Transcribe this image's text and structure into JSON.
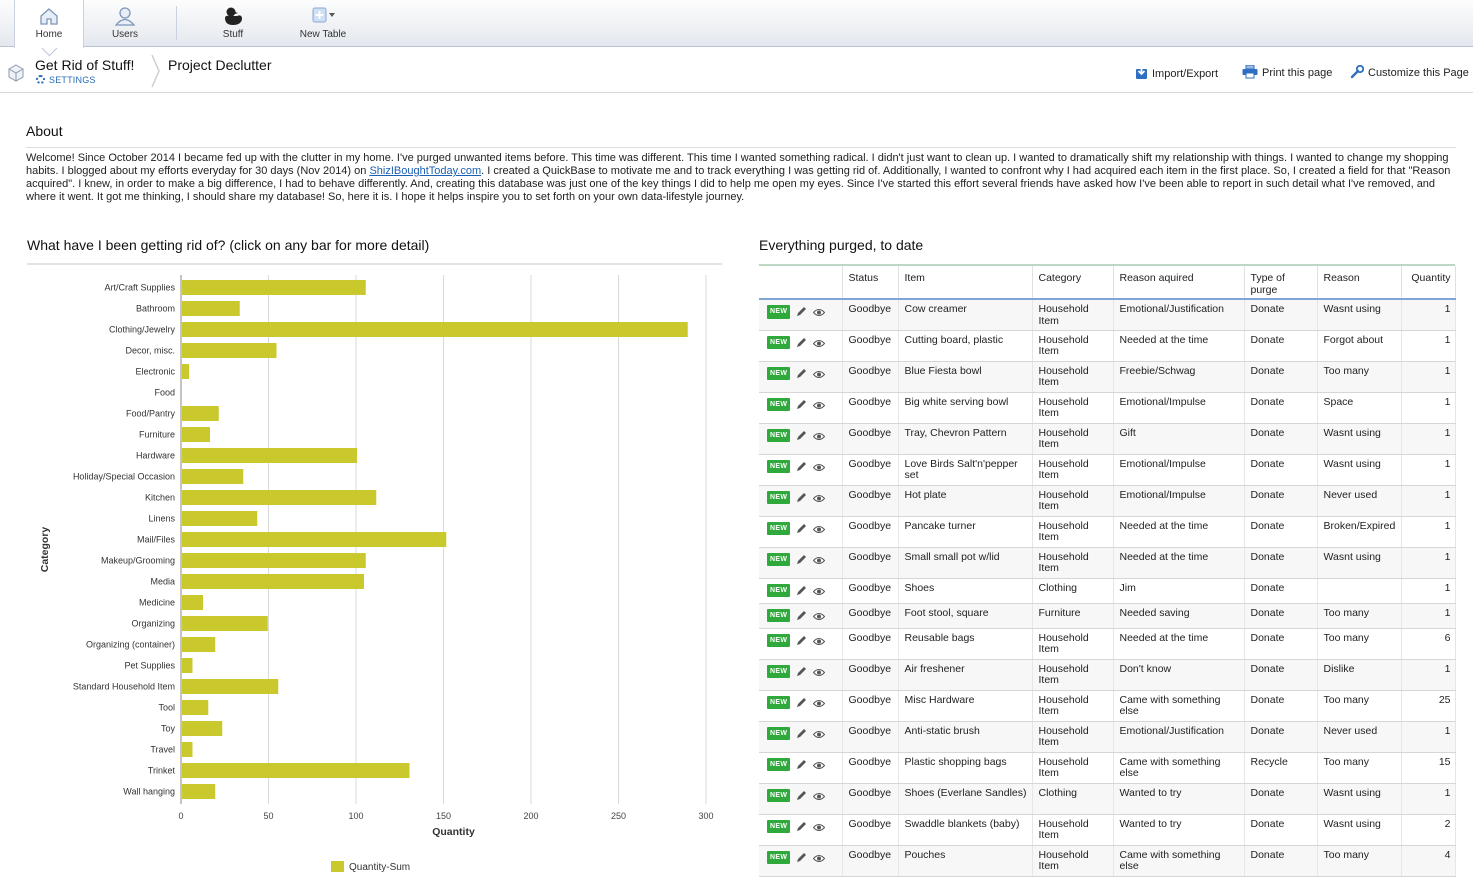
{
  "nav": {
    "items": [
      {
        "label": "Home"
      },
      {
        "label": "Users"
      },
      {
        "label": "Stuff"
      },
      {
        "label": "New Table"
      }
    ]
  },
  "header": {
    "app_title": "Get Rid of Stuff!",
    "settings_label": "SETTINGS",
    "page_name": "Project Declutter",
    "import_export": "Import/Export",
    "print_page": "Print this page",
    "customize_page": "Customize this Page"
  },
  "about": {
    "title": "About",
    "text_before_link": "Welcome! Since October 2014 I became fed up with the clutter in my home. I've purged unwanted items before. This time was different. This time I wanted something radical. I didn't just want to clean up. I wanted to dramatically shift my relationship with things. I wanted to change my shopping habits. I blogged about my efforts everyday for 30 days (Nov 2014) on ",
    "link_text": "ShizIBoughtToday.com",
    "text_after_link": ". I created a QuickBase to motivate me and to track everything I was getting rid of. Additionally, I wanted to confront why I had acquired each item in the first place. So, I created a field for that \"Reason acquired\".  I knew, in order to make a big difference, I had to behave differently. And, creating this database was just one of the key things I did to help me open my eyes. Since I've started this effort several friends have asked how I've been able to report in such detail what I've removed, and where it went. It got me thinking, I should share my database! So, here it is. I hope it helps inspire you to set forth on your own data-lifestyle journey."
  },
  "chart_title": "What have I been getting rid of? (click on any bar for more detail)",
  "chart_data": {
    "type": "bar",
    "orientation": "horizontal",
    "categories": [
      "Art/Craft Supplies",
      "Bathroom",
      "Clothing/Jewelry",
      "Decor, misc.",
      "Electronic",
      "Food",
      "Food/Pantry",
      "Furniture",
      "Hardware",
      "Holiday/Special Occasion",
      "Kitchen",
      "Linens",
      "Mail/Files",
      "Makeup/Grooming",
      "Media",
      "Medicine",
      "Organizing",
      "Organizing (container)",
      "Pet Supplies",
      "Standard Household Item",
      "Tool",
      "Toy",
      "Travel",
      "Trinket",
      "Wall hanging"
    ],
    "series": [
      {
        "name": "Quantity-Sum",
        "values": [
          105,
          33,
          289,
          54,
          4,
          0,
          21,
          16,
          100,
          35,
          111,
          43,
          151,
          105,
          104,
          12,
          49,
          19,
          6,
          55,
          15,
          23,
          6,
          130,
          19
        ]
      }
    ],
    "xlabel": "Quantity",
    "ylabel": "Category",
    "xlim": [
      0,
      300
    ],
    "xticks": [
      "0",
      "50",
      "100",
      "150",
      "200",
      "250",
      "300"
    ],
    "grid": true,
    "legend": "bottom",
    "bar_color": "#c9c92e"
  },
  "table": {
    "title": "Everything purged, to date",
    "badge_label": "NEW",
    "columns": [
      "Status",
      "Item",
      "Category",
      "Reason aquired",
      "Type of purge",
      "Reason",
      "Quantity"
    ],
    "rows": [
      {
        "status": "Goodbye",
        "item": "Cow creamer",
        "category": "Household Item",
        "reason_acquired": "Emotional/Justification",
        "purge_type": "Donate",
        "reason": "Wasnt using",
        "quantity": "1"
      },
      {
        "status": "Goodbye",
        "item": "Cutting board, plastic",
        "category": "Household Item",
        "reason_acquired": "Needed at the time",
        "purge_type": "Donate",
        "reason": "Forgot about",
        "quantity": "1"
      },
      {
        "status": "Goodbye",
        "item": "Blue Fiesta bowl",
        "category": "Household Item",
        "reason_acquired": "Freebie/Schwag",
        "purge_type": "Donate",
        "reason": "Too many",
        "quantity": "1"
      },
      {
        "status": "Goodbye",
        "item": "Big white serving bowl",
        "category": "Household Item",
        "reason_acquired": "Emotional/Impulse",
        "purge_type": "Donate",
        "reason": "Space",
        "quantity": "1"
      },
      {
        "status": "Goodbye",
        "item": "Tray, Chevron Pattern",
        "category": "Household Item",
        "reason_acquired": "Gift",
        "purge_type": "Donate",
        "reason": "Wasnt using",
        "quantity": "1"
      },
      {
        "status": "Goodbye",
        "item": "Love Birds Salt'n'pepper set",
        "category": "Household Item",
        "reason_acquired": "Emotional/Impulse",
        "purge_type": "Donate",
        "reason": "Wasnt using",
        "quantity": "1"
      },
      {
        "status": "Goodbye",
        "item": "Hot plate",
        "category": "Household Item",
        "reason_acquired": "Emotional/Impulse",
        "purge_type": "Donate",
        "reason": "Never used",
        "quantity": "1"
      },
      {
        "status": "Goodbye",
        "item": "Pancake turner",
        "category": "Household Item",
        "reason_acquired": "Needed at the time",
        "purge_type": "Donate",
        "reason": "Broken/Expired",
        "quantity": "1"
      },
      {
        "status": "Goodbye",
        "item": "Small small pot w/lid",
        "category": "Household Item",
        "reason_acquired": "Needed at the time",
        "purge_type": "Donate",
        "reason": "Wasnt using",
        "quantity": "1"
      },
      {
        "status": "Goodbye",
        "item": "Shoes",
        "category": "Clothing",
        "reason_acquired": "Jim",
        "purge_type": "Donate",
        "reason": "",
        "quantity": "1"
      },
      {
        "status": "Goodbye",
        "item": "Foot stool, square",
        "category": "Furniture",
        "reason_acquired": "Needed saving",
        "purge_type": "Donate",
        "reason": "Too many",
        "quantity": "1"
      },
      {
        "status": "Goodbye",
        "item": "Reusable bags",
        "category": "Household Item",
        "reason_acquired": "Needed at the time",
        "purge_type": "Donate",
        "reason": "Too many",
        "quantity": "6"
      },
      {
        "status": "Goodbye",
        "item": "Air freshener",
        "category": "Household Item",
        "reason_acquired": "Don't know",
        "purge_type": "Donate",
        "reason": "Dislike",
        "quantity": "1"
      },
      {
        "status": "Goodbye",
        "item": "Misc Hardware",
        "category": "Household Item",
        "reason_acquired": "Came with something else",
        "purge_type": "Donate",
        "reason": "Too many",
        "quantity": "25"
      },
      {
        "status": "Goodbye",
        "item": "Anti-static brush",
        "category": "Household Item",
        "reason_acquired": "Emotional/Justification",
        "purge_type": "Donate",
        "reason": "Never used",
        "quantity": "1"
      },
      {
        "status": "Goodbye",
        "item": "Plastic shopping bags",
        "category": "Household Item",
        "reason_acquired": "Came with something else",
        "purge_type": "Recycle",
        "reason": "Too many",
        "quantity": "15"
      },
      {
        "status": "Goodbye",
        "item": "Shoes (Everlane Sandles)",
        "category": "Clothing",
        "reason_acquired": "Wanted to try",
        "purge_type": "Donate",
        "reason": "Wasnt using",
        "quantity": "1"
      },
      {
        "status": "Goodbye",
        "item": "Swaddle blankets (baby)",
        "category": "Household Item",
        "reason_acquired": "Wanted to try",
        "purge_type": "Donate",
        "reason": "Wasnt using",
        "quantity": "2"
      },
      {
        "status": "Goodbye",
        "item": "Pouches",
        "category": "Household Item",
        "reason_acquired": "Came with something else",
        "purge_type": "Donate",
        "reason": "Too many",
        "quantity": "4"
      }
    ]
  }
}
